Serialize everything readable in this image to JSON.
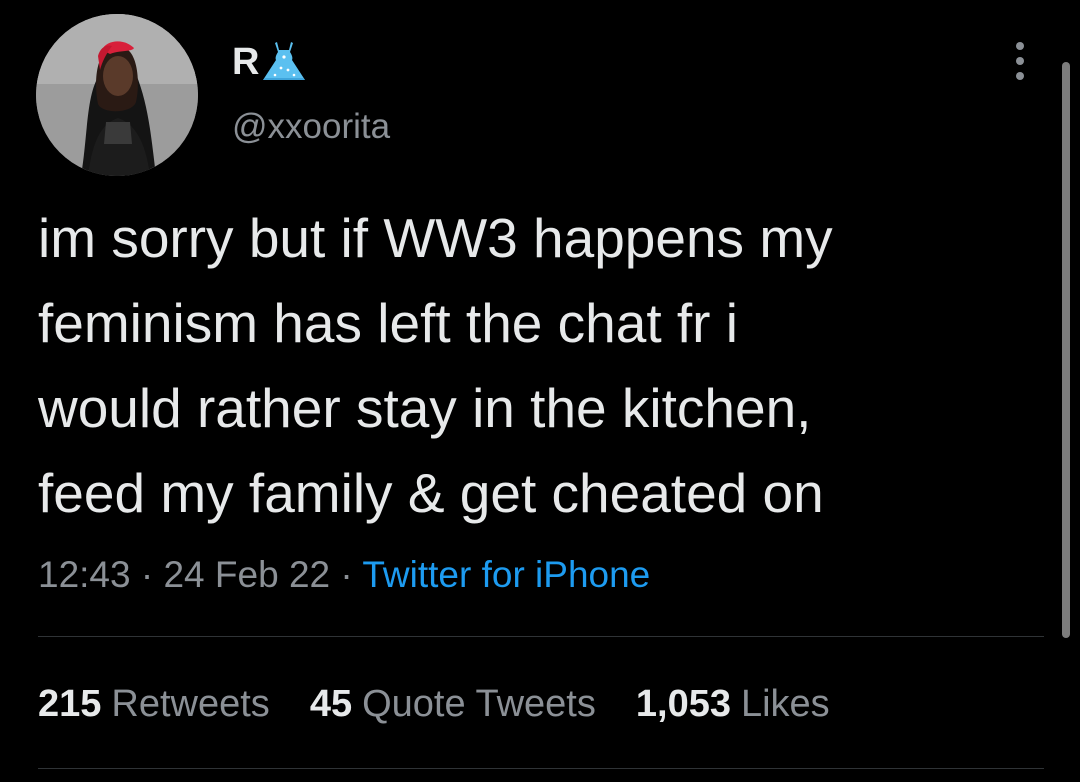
{
  "author": {
    "display_name": "R",
    "name_emoji_icon": "dress-icon",
    "handle": "@xxoorita",
    "avatar_icon": "profile-photo"
  },
  "tweet": {
    "lines": [
      "im sorry but if WW3 happens my",
      "feminism has left the chat fr i",
      "would rather stay in the kitchen,",
      "feed my family & get cheated on"
    ],
    "time": "12:43",
    "separator": " · ",
    "date": "24 Feb 22",
    "source": "Twitter for iPhone"
  },
  "stats": {
    "retweets_count": "215",
    "retweets_label": "Retweets",
    "quotes_count": "45",
    "quotes_label": "Quote Tweets",
    "likes_count": "1,053",
    "likes_label": "Likes"
  },
  "colors": {
    "background": "#000000",
    "text": "#e7e9ea",
    "secondary": "#8b9096",
    "link": "#1d9bf0",
    "divider": "#2f3336",
    "dress": "#5bc0f0"
  }
}
